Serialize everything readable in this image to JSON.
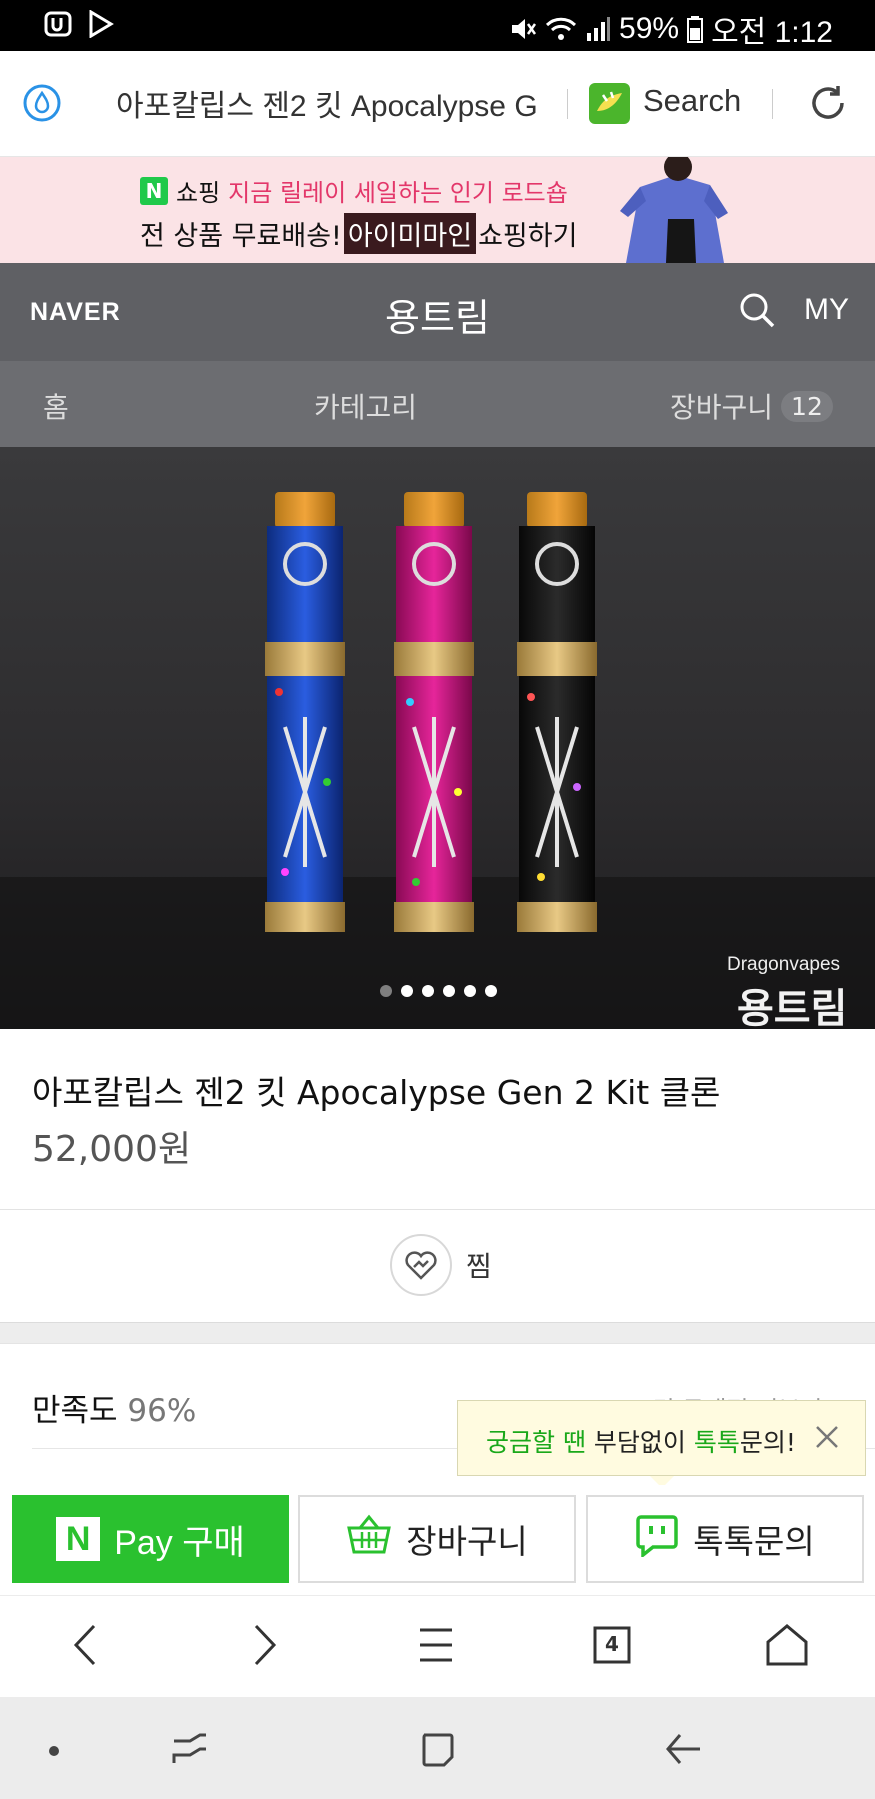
{
  "status_bar": {
    "battery": "59%",
    "time": "오전 1:12"
  },
  "browser": {
    "page_title": "아포칼립스 젠2 킷 Apocalypse G",
    "search_label": "Search",
    "tabs_count": "4"
  },
  "ad_banner": {
    "shop_label": "쇼핑",
    "line1_highlight": "지금 릴레이 세일하는 인기 로드숍",
    "line2_prefix": "전 상품 무료배송!",
    "line2_brand": "아이미마인",
    "line2_suffix": "쇼핑하기",
    "badge": "N"
  },
  "header": {
    "logo": "NAVER",
    "store_name": "용트림",
    "my_label": "MY"
  },
  "subnav": {
    "home": "홈",
    "category": "카테고리",
    "cart": "장바구니",
    "cart_count": "12"
  },
  "product": {
    "image_watermark_top": "Dragonvapes",
    "image_watermark_bottom": "용트림",
    "image_page_count": 6,
    "image_page_active": 1,
    "title": "아포칼립스 젠2 킷 Apocalypse Gen 2 Kit 클론",
    "price": "52,000원",
    "zzim_label": "찜"
  },
  "satisfaction": {
    "label": "만족도",
    "value": "96%",
    "review_link": "18건 구매평 더보기 ›"
  },
  "tooltip": {
    "part1": "궁금할 땐",
    "part2": " 부담없이 ",
    "part3": "톡톡",
    "part4": "문의!"
  },
  "actions": {
    "pay_n": "N",
    "pay_label": "Pay 구매",
    "cart_label": "장바구니",
    "talk_label": "톡톡문의"
  },
  "colors": {
    "naver_green": "#2ac12f",
    "header_gray": "#5f6064",
    "subnav_gray": "#6c6d71",
    "ad_pink": "#fbe3e6"
  }
}
